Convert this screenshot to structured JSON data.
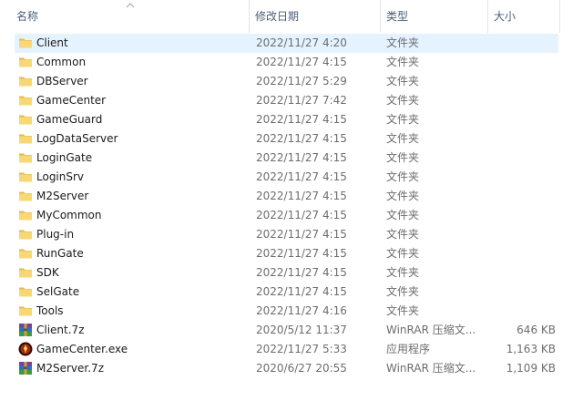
{
  "columns": {
    "name": "名称",
    "date": "修改日期",
    "type": "类型",
    "size": "大小"
  },
  "files": [
    {
      "name": "Client",
      "date": "2022/11/27 4:20",
      "type": "文件夹",
      "size": "",
      "icon": "folder-icon",
      "selected": true
    },
    {
      "name": "Common",
      "date": "2022/11/27 4:15",
      "type": "文件夹",
      "size": "",
      "icon": "folder-icon"
    },
    {
      "name": "DBServer",
      "date": "2022/11/27 5:29",
      "type": "文件夹",
      "size": "",
      "icon": "folder-icon"
    },
    {
      "name": "GameCenter",
      "date": "2022/11/27 7:42",
      "type": "文件夹",
      "size": "",
      "icon": "folder-icon"
    },
    {
      "name": "GameGuard",
      "date": "2022/11/27 4:15",
      "type": "文件夹",
      "size": "",
      "icon": "folder-icon"
    },
    {
      "name": "LogDataServer",
      "date": "2022/11/27 4:15",
      "type": "文件夹",
      "size": "",
      "icon": "folder-icon"
    },
    {
      "name": "LoginGate",
      "date": "2022/11/27 4:15",
      "type": "文件夹",
      "size": "",
      "icon": "folder-icon"
    },
    {
      "name": "LoginSrv",
      "date": "2022/11/27 4:15",
      "type": "文件夹",
      "size": "",
      "icon": "folder-icon"
    },
    {
      "name": "M2Server",
      "date": "2022/11/27 4:15",
      "type": "文件夹",
      "size": "",
      "icon": "folder-icon"
    },
    {
      "name": "MyCommon",
      "date": "2022/11/27 4:15",
      "type": "文件夹",
      "size": "",
      "icon": "folder-icon"
    },
    {
      "name": "Plug-in",
      "date": "2022/11/27 4:15",
      "type": "文件夹",
      "size": "",
      "icon": "folder-icon"
    },
    {
      "name": "RunGate",
      "date": "2022/11/27 4:15",
      "type": "文件夹",
      "size": "",
      "icon": "folder-icon"
    },
    {
      "name": "SDK",
      "date": "2022/11/27 4:15",
      "type": "文件夹",
      "size": "",
      "icon": "folder-icon"
    },
    {
      "name": "SelGate",
      "date": "2022/11/27 4:15",
      "type": "文件夹",
      "size": "",
      "icon": "folder-icon"
    },
    {
      "name": "Tools",
      "date": "2022/11/27 4:16",
      "type": "文件夹",
      "size": "",
      "icon": "folder-icon"
    },
    {
      "name": "Client.7z",
      "date": "2020/5/12 11:37",
      "type": "WinRAR 压缩文...",
      "size": "646 KB",
      "icon": "winrar-archive-icon"
    },
    {
      "name": "GameCenter.exe",
      "date": "2022/11/27 5:33",
      "type": "应用程序",
      "size": "1,163 KB",
      "icon": "application-icon"
    },
    {
      "name": "M2Server.7z",
      "date": "2020/6/27 20:55",
      "type": "WinRAR 压缩文...",
      "size": "1,109 KB",
      "icon": "winrar-archive-icon"
    }
  ],
  "colors": {
    "folder": "#f8d775",
    "selection": "#e5f3ff",
    "header_text": "#4c607a"
  }
}
